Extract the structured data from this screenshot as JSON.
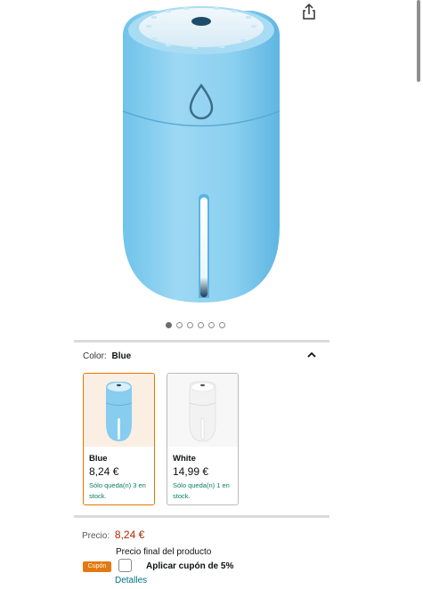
{
  "product": {
    "image_alt": "humidifier",
    "image_count": 6,
    "active_image": 1
  },
  "toolbar": {
    "share_icon": "share-icon"
  },
  "variation": {
    "label": "Color:",
    "selected": "Blue",
    "collapse_icon": "chevron-up-icon",
    "options": [
      {
        "name": "Blue",
        "price": "8,24 €",
        "stock": "Sólo queda(n) 3 en stock.",
        "color": "#8ed3f1"
      },
      {
        "name": "White",
        "price": "14,99 €",
        "stock": "Sólo queda(n) 1 en stock.",
        "color": "#f4f4f4"
      }
    ]
  },
  "price": {
    "label": "Precio:",
    "value": "8,24 €",
    "final_text": "Precio final del producto"
  },
  "coupon": {
    "badge": "Cupón",
    "text": "Aplicar cupón de 5%",
    "details": "Detalles",
    "checked": false
  },
  "colors": {
    "accent": "#e77600",
    "price": "#b12704",
    "stock": "#067d62",
    "link": "#007185",
    "coupon_badge": "#e47911"
  }
}
